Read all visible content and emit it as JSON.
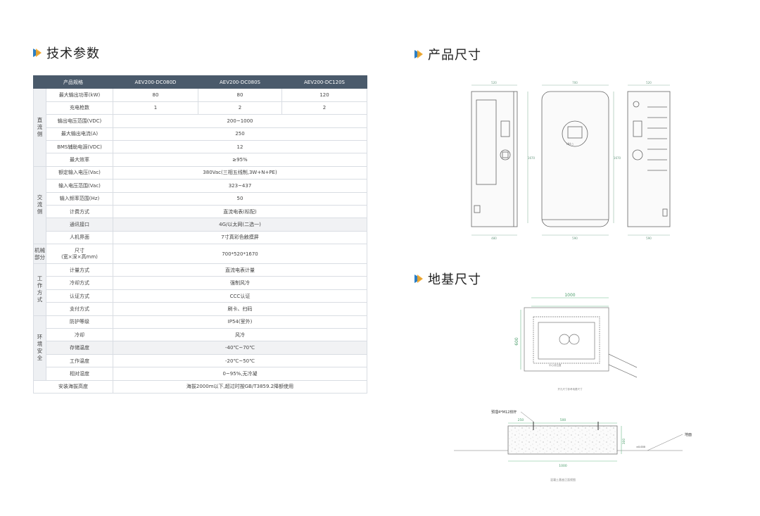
{
  "headings": {
    "tech": "技术参数",
    "product_size": "产品尺寸",
    "foundation_size": "地基尺寸"
  },
  "table": {
    "header": [
      "产品规格",
      "AEV200-DC080D",
      "AEV200-DC080S",
      "AEV200-DC120S"
    ],
    "groups": [
      {
        "name": "直流侧",
        "rows": [
          {
            "label": "最大输出功率(kW)",
            "values": [
              "80",
              "80",
              "120"
            ]
          },
          {
            "label": "充电枪数",
            "values": [
              "1",
              "2",
              "2"
            ]
          },
          {
            "label": "输出电压范围(VDC)",
            "values": [
              "200~1000"
            ]
          },
          {
            "label": "最大输出电流(A)",
            "values": [
              "250"
            ]
          },
          {
            "label": "BMS辅助电源(VDC)",
            "values": [
              "12"
            ]
          },
          {
            "label": "最大效率",
            "values": [
              "≥95%"
            ]
          }
        ]
      },
      {
        "name": "交流侧",
        "rows": [
          {
            "label": "额定输入电压(Vac)",
            "values": [
              "380Vac(三相五线制,3W+N+PE)"
            ]
          },
          {
            "label": "输入电压范围(Vac)",
            "values": [
              "323~437"
            ]
          },
          {
            "label": "输入频率范围(Hz)",
            "values": [
              "50"
            ]
          },
          {
            "label": "计费方式",
            "values": [
              "直流电表(标配)"
            ]
          },
          {
            "label": "通讯接口",
            "values": [
              "4G/以太网(二选一)"
            ],
            "shade": true
          },
          {
            "label": "人机界面",
            "values": [
              "7寸真彩色触摸屏"
            ]
          }
        ]
      },
      {
        "name": "机械部分",
        "horizontal": true,
        "rows": [
          {
            "label": "尺寸\n(宽×深×高mm)",
            "values": [
              "700*520*1670"
            ],
            "tall": true
          }
        ]
      },
      {
        "name": "工作方式",
        "rows": [
          {
            "label": "计量方式",
            "values": [
              "直流电表计量"
            ]
          },
          {
            "label": "冷却方式",
            "values": [
              "强制风冷"
            ]
          },
          {
            "label": "认证方式",
            "values": [
              "CCC认证"
            ]
          },
          {
            "label": "支付方式",
            "values": [
              "刷卡、扫码"
            ]
          }
        ]
      },
      {
        "name": "环境安全",
        "rows": [
          {
            "label": "防护等级",
            "values": [
              "IP54(室外)"
            ]
          },
          {
            "label": "冷却",
            "values": [
              "风冷"
            ]
          },
          {
            "label": "存储温度",
            "values": [
              "-40℃~70℃"
            ],
            "shade": true
          },
          {
            "label": "工作温度",
            "values": [
              "-20℃~50℃"
            ]
          },
          {
            "label": "相对湿度",
            "values": [
              "0~95%,无冷凝"
            ]
          },
          {
            "label": "安装海拔高度",
            "values": [
              "海拔2000m以下,超过时按GB/T3859.2降额使用"
            ],
            "span_label": true
          }
        ]
      }
    ]
  },
  "product_drawing": {
    "dims_top": [
      "520",
      "700",
      "520"
    ],
    "dims_bottom": [
      "480",
      "590",
      "590"
    ],
    "height_labels": [
      "1670",
      "1670"
    ],
    "screen_text": "HH ▯"
  },
  "foundation_plan": {
    "width_label": "1000",
    "depth_label": "600",
    "caption": "开孔尺寸参考地基尺寸",
    "center_label": "中心线位置"
  },
  "foundation_section": {
    "bolt_label": "预埋4*M12校杆",
    "dim_top": [
      "250",
      "500"
    ],
    "dim_bottom": "1000",
    "dim_side": "300",
    "ground_label": "地面",
    "level_label": "±0.000",
    "caption": "混凝土基座正面视图"
  }
}
